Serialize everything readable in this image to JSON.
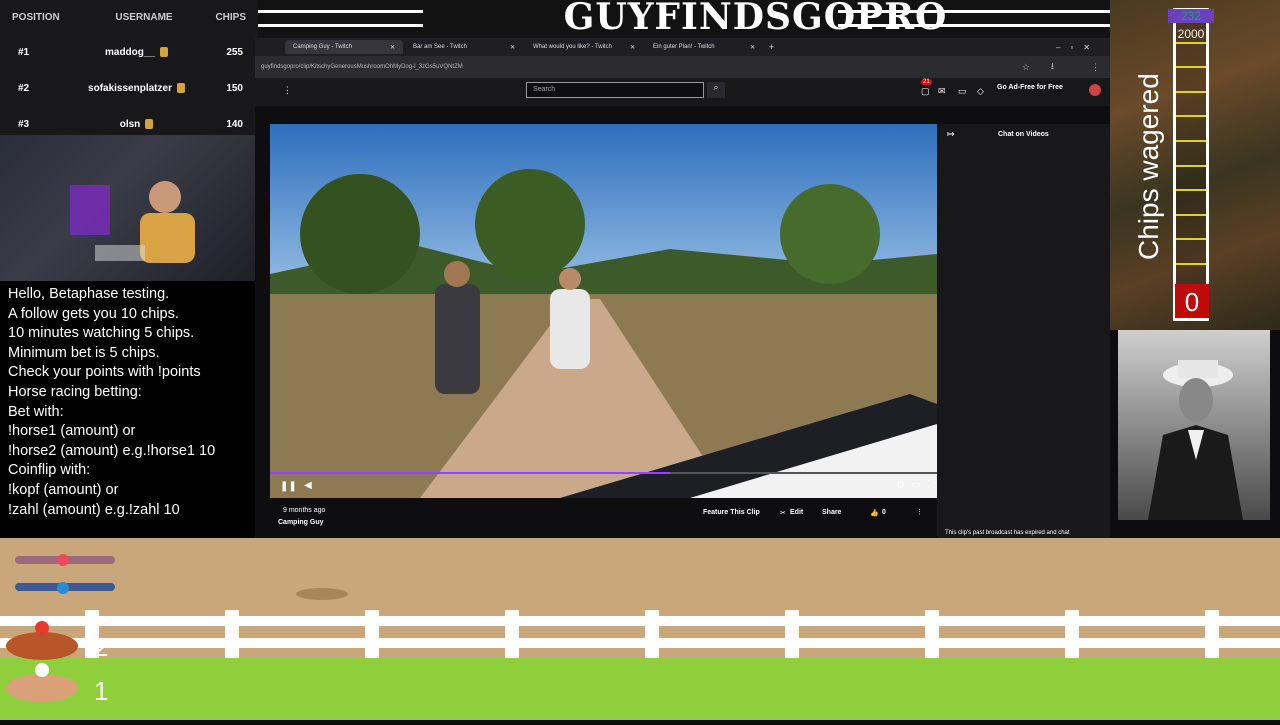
{
  "banner": {
    "title": "GUYFINDSGOPRO"
  },
  "leaderboard": {
    "headers": {
      "position": "POSITION",
      "username": "USERNAME",
      "chips": "CHIPS"
    },
    "rows": [
      {
        "position": "#1",
        "username": "maddog__",
        "chips": "255"
      },
      {
        "position": "#2",
        "username": "sofakissenplatzer",
        "chips": "150"
      },
      {
        "position": "#3",
        "username": "olsn",
        "chips": "140"
      }
    ]
  },
  "info_text": "Hello, Betaphase testing.\nA follow gets you 10 chips.\n10 minutes watching 5 chips.\nMinimum bet is 5 chips.\nCheck your points with !points\nHorse racing betting:\nBet with:\n!horse1 (amount) or\n!horse2 (amount) e.g.!horse1 10\nCoinflip with:\n!kopf (amount) or\n!zahl (amount) e.g.!zahl 10",
  "browser": {
    "tabs": [
      {
        "label": "Camping Guy - Twitch",
        "active": true
      },
      {
        "label": "Bar am See - Twitch",
        "active": false
      },
      {
        "label": "What would you like? - Twitch",
        "active": false
      },
      {
        "label": "Ein guter Plan! - Twitch",
        "active": false
      }
    ],
    "url": "guyfindsgopro/clip/KitschyGenerousMushroomOhMyDog-l_3zGs5uVQNtZM",
    "search_placeholder": "Search",
    "notification_count": "21",
    "ad_free_label": "Go Ad-Free for Free",
    "chat_label": "Chat on Videos",
    "chat_expired": "This clip's past broadcast has expired and chat",
    "clip": {
      "age": "9 months ago",
      "title": "Camping Guy",
      "feature_label": "Feature This Clip",
      "edit_label": "Edit",
      "share_label": "Share",
      "like_count": "0"
    }
  },
  "wager": {
    "label": "Chips wagered",
    "top_value": "232",
    "max_value": "2000",
    "current": "0"
  },
  "race": {
    "lanes": [
      "2",
      "1"
    ]
  },
  "colors": {
    "accent": "#9147ff",
    "meter_fill": "#c00a0a",
    "grass": "#8fcf3c",
    "dirt": "#c9a77a"
  }
}
